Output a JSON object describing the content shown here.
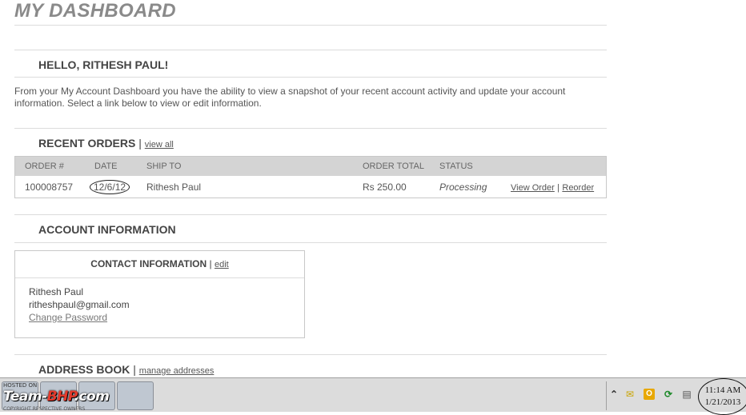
{
  "page_title": "MY DASHBOARD",
  "greeting": "HELLO, RITHESH PAUL!",
  "intro": "From your My Account Dashboard you have the ability to view a snapshot of your recent account activity and update your account information. Select a link below to view or edit information.",
  "recent_orders": {
    "heading": "RECENT ORDERS",
    "separator": "|",
    "view_all": "view all",
    "columns": [
      "ORDER #",
      "DATE",
      "SHIP TO",
      "ORDER TOTAL",
      "STATUS"
    ],
    "rows": [
      {
        "order": "100008757",
        "date": "12/6/12",
        "ship_to": "Rithesh Paul",
        "total": "Rs 250.00",
        "status": "Processing",
        "view_order": "View Order",
        "action_sep": "|",
        "reorder": "Reorder"
      }
    ]
  },
  "account_info": {
    "heading": "ACCOUNT INFORMATION",
    "contact": {
      "heading": "CONTACT INFORMATION",
      "separator": "|",
      "edit": "edit",
      "name": "Rithesh Paul",
      "email": "ritheshpaul@gmail.com",
      "change_password": "Change Password"
    }
  },
  "address_book": {
    "heading": "ADDRESS BOOK",
    "separator": "|",
    "manage": "manage addresses"
  },
  "taskbar": {
    "watermark_top": "HOSTED ON",
    "logo_team": "Team-",
    "logo_bhp": "BHP",
    "logo_com": ".com",
    "watermark_bottom": "COPYRIGHT RESPECTIVE OWNERS",
    "clock_time": "11:14 AM",
    "clock_date": "1/21/2013",
    "tray_icons": [
      "chevron-up-icon",
      "mail-icon",
      "office-icon",
      "sync-icon",
      "network-icon"
    ]
  },
  "colors": {
    "title": "#8a8a8a",
    "table_header_bg": "#d4d4d4",
    "logo_accent": "#e53a2c"
  }
}
